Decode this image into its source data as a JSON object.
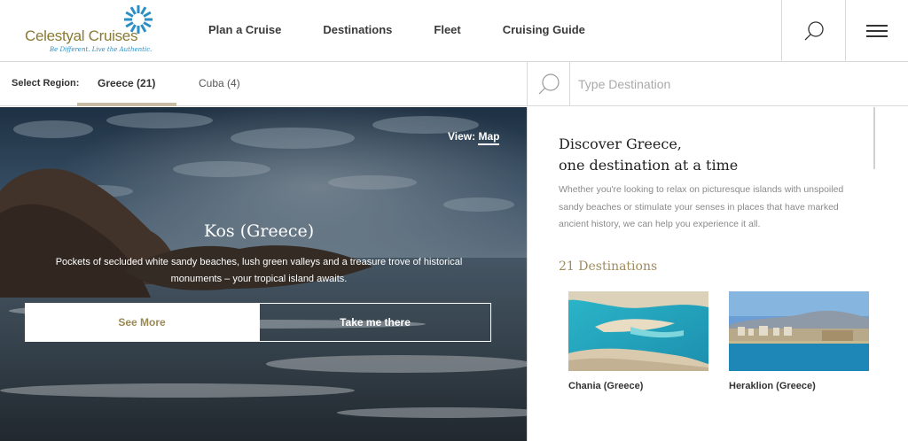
{
  "brand": {
    "name": "Celestyal Cruises",
    "tagline": "Be Different. Live the Authentic.",
    "colors": {
      "gold": "#9c8a55",
      "blue": "#2a8fc4",
      "text": "#3a3a3a"
    }
  },
  "nav": {
    "items": [
      {
        "label": "Plan a Cruise"
      },
      {
        "label": "Destinations"
      },
      {
        "label": "Fleet"
      },
      {
        "label": "Cruising Guide"
      }
    ],
    "search_icon": "search-icon",
    "menu_icon": "hamburger-menu-icon"
  },
  "region": {
    "label": "Select Region:",
    "tabs": [
      {
        "label": "Greece (21)",
        "active": true
      },
      {
        "label": "Cuba (4)",
        "active": false
      }
    ]
  },
  "destination_search": {
    "placeholder": "Type Destination",
    "value": ""
  },
  "hero": {
    "view_prefix": "View:",
    "view_link": "Map",
    "title": "Kos (Greece)",
    "description": "Pockets of secluded white sandy beaches, lush green valleys and a treasure trove of historical monuments – your tropical island awaits.",
    "see_more_label": "See More",
    "take_me_label": "Take me there"
  },
  "panel": {
    "heading_line1": "Discover Greece,",
    "heading_line2": "one destination at a time",
    "description": "Whether you're looking to relax on picturesque islands with unspoiled sandy beaches or stimulate your senses in places that have marked ancient history, we can help you experience it all.",
    "count_label": "21 Destinations",
    "cards": [
      {
        "name": "Chania (Greece)"
      },
      {
        "name": "Heraklion (Greece)"
      }
    ]
  }
}
